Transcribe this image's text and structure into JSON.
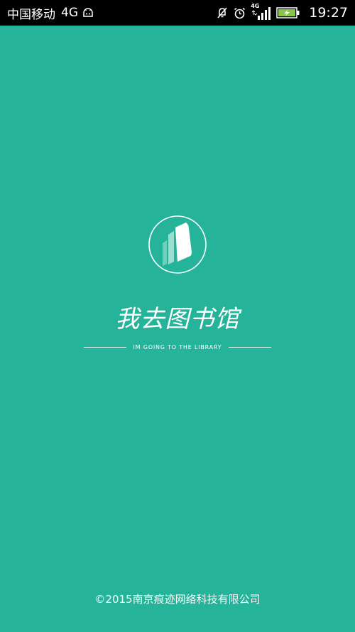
{
  "status_bar": {
    "carrier": "中国移动",
    "network": "4G",
    "signal_tag": "4G",
    "time": "19:27",
    "icons": [
      "android-icon",
      "mute-icon",
      "alarm-icon",
      "signal-icon",
      "battery-charging-icon"
    ],
    "colors": {
      "background": "#000000",
      "battery_fill": "#8bc34a"
    }
  },
  "splash": {
    "title": "我去图书馆",
    "subtitle": "IM GOING TO THE LIBRARY",
    "copyright": "©2015南京痕迹网络科技有限公司",
    "logo_icon": "book-pages-icon",
    "colors": {
      "background": "#25b49a",
      "foreground": "#ffffff"
    }
  }
}
